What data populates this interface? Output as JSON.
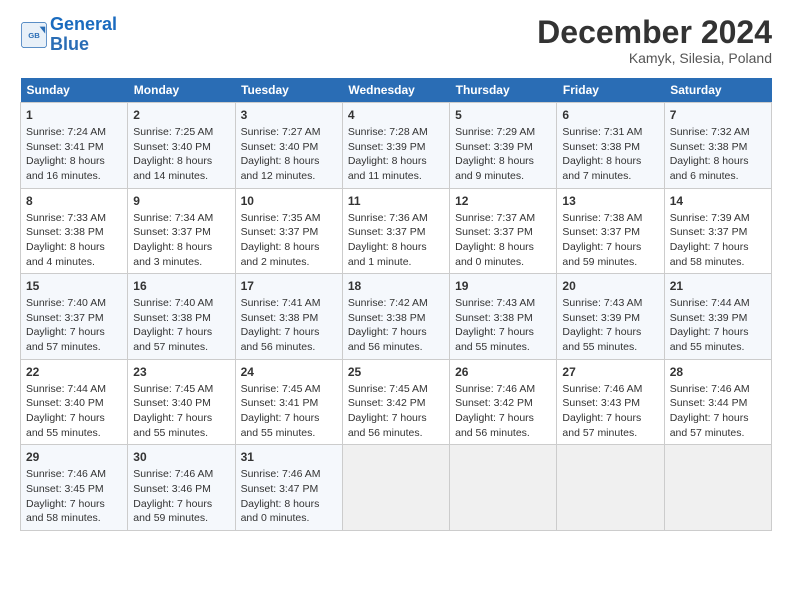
{
  "header": {
    "logo_line1": "General",
    "logo_line2": "Blue",
    "month": "December 2024",
    "location": "Kamyk, Silesia, Poland"
  },
  "days_of_week": [
    "Sunday",
    "Monday",
    "Tuesday",
    "Wednesday",
    "Thursday",
    "Friday",
    "Saturday"
  ],
  "weeks": [
    [
      {
        "day": "1",
        "info": "Sunrise: 7:24 AM\nSunset: 3:41 PM\nDaylight: 8 hours and 16 minutes."
      },
      {
        "day": "2",
        "info": "Sunrise: 7:25 AM\nSunset: 3:40 PM\nDaylight: 8 hours and 14 minutes."
      },
      {
        "day": "3",
        "info": "Sunrise: 7:27 AM\nSunset: 3:40 PM\nDaylight: 8 hours and 12 minutes."
      },
      {
        "day": "4",
        "info": "Sunrise: 7:28 AM\nSunset: 3:39 PM\nDaylight: 8 hours and 11 minutes."
      },
      {
        "day": "5",
        "info": "Sunrise: 7:29 AM\nSunset: 3:39 PM\nDaylight: 8 hours and 9 minutes."
      },
      {
        "day": "6",
        "info": "Sunrise: 7:31 AM\nSunset: 3:38 PM\nDaylight: 8 hours and 7 minutes."
      },
      {
        "day": "7",
        "info": "Sunrise: 7:32 AM\nSunset: 3:38 PM\nDaylight: 8 hours and 6 minutes."
      }
    ],
    [
      {
        "day": "8",
        "info": "Sunrise: 7:33 AM\nSunset: 3:38 PM\nDaylight: 8 hours and 4 minutes."
      },
      {
        "day": "9",
        "info": "Sunrise: 7:34 AM\nSunset: 3:37 PM\nDaylight: 8 hours and 3 minutes."
      },
      {
        "day": "10",
        "info": "Sunrise: 7:35 AM\nSunset: 3:37 PM\nDaylight: 8 hours and 2 minutes."
      },
      {
        "day": "11",
        "info": "Sunrise: 7:36 AM\nSunset: 3:37 PM\nDaylight: 8 hours and 1 minute."
      },
      {
        "day": "12",
        "info": "Sunrise: 7:37 AM\nSunset: 3:37 PM\nDaylight: 8 hours and 0 minutes."
      },
      {
        "day": "13",
        "info": "Sunrise: 7:38 AM\nSunset: 3:37 PM\nDaylight: 7 hours and 59 minutes."
      },
      {
        "day": "14",
        "info": "Sunrise: 7:39 AM\nSunset: 3:37 PM\nDaylight: 7 hours and 58 minutes."
      }
    ],
    [
      {
        "day": "15",
        "info": "Sunrise: 7:40 AM\nSunset: 3:37 PM\nDaylight: 7 hours and 57 minutes."
      },
      {
        "day": "16",
        "info": "Sunrise: 7:40 AM\nSunset: 3:38 PM\nDaylight: 7 hours and 57 minutes."
      },
      {
        "day": "17",
        "info": "Sunrise: 7:41 AM\nSunset: 3:38 PM\nDaylight: 7 hours and 56 minutes."
      },
      {
        "day": "18",
        "info": "Sunrise: 7:42 AM\nSunset: 3:38 PM\nDaylight: 7 hours and 56 minutes."
      },
      {
        "day": "19",
        "info": "Sunrise: 7:43 AM\nSunset: 3:38 PM\nDaylight: 7 hours and 55 minutes."
      },
      {
        "day": "20",
        "info": "Sunrise: 7:43 AM\nSunset: 3:39 PM\nDaylight: 7 hours and 55 minutes."
      },
      {
        "day": "21",
        "info": "Sunrise: 7:44 AM\nSunset: 3:39 PM\nDaylight: 7 hours and 55 minutes."
      }
    ],
    [
      {
        "day": "22",
        "info": "Sunrise: 7:44 AM\nSunset: 3:40 PM\nDaylight: 7 hours and 55 minutes."
      },
      {
        "day": "23",
        "info": "Sunrise: 7:45 AM\nSunset: 3:40 PM\nDaylight: 7 hours and 55 minutes."
      },
      {
        "day": "24",
        "info": "Sunrise: 7:45 AM\nSunset: 3:41 PM\nDaylight: 7 hours and 55 minutes."
      },
      {
        "day": "25",
        "info": "Sunrise: 7:45 AM\nSunset: 3:42 PM\nDaylight: 7 hours and 56 minutes."
      },
      {
        "day": "26",
        "info": "Sunrise: 7:46 AM\nSunset: 3:42 PM\nDaylight: 7 hours and 56 minutes."
      },
      {
        "day": "27",
        "info": "Sunrise: 7:46 AM\nSunset: 3:43 PM\nDaylight: 7 hours and 57 minutes."
      },
      {
        "day": "28",
        "info": "Sunrise: 7:46 AM\nSunset: 3:44 PM\nDaylight: 7 hours and 57 minutes."
      }
    ],
    [
      {
        "day": "29",
        "info": "Sunrise: 7:46 AM\nSunset: 3:45 PM\nDaylight: 7 hours and 58 minutes."
      },
      {
        "day": "30",
        "info": "Sunrise: 7:46 AM\nSunset: 3:46 PM\nDaylight: 7 hours and 59 minutes."
      },
      {
        "day": "31",
        "info": "Sunrise: 7:46 AM\nSunset: 3:47 PM\nDaylight: 8 hours and 0 minutes."
      },
      null,
      null,
      null,
      null
    ]
  ]
}
